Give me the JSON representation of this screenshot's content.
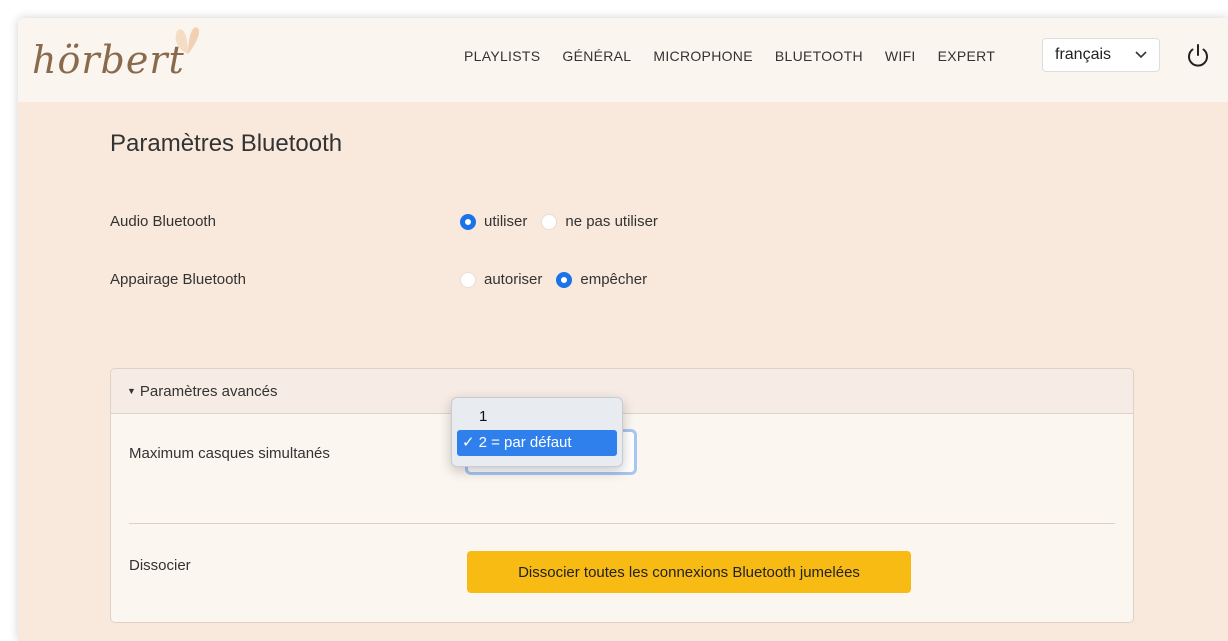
{
  "brand": {
    "logo_text": "hörbert"
  },
  "nav": {
    "links": [
      "PLAYLISTS",
      "GÉNÉRAL",
      "MICROPHONE",
      "BLUETOOTH",
      "WIFI",
      "EXPERT"
    ]
  },
  "language": {
    "selected": "français"
  },
  "page": {
    "title": "Paramètres Bluetooth"
  },
  "settings": {
    "audio": {
      "label": "Audio Bluetooth",
      "options": [
        "utiliser",
        "ne pas utiliser"
      ],
      "selected_index": 0
    },
    "pairing": {
      "label": "Appairage Bluetooth",
      "options": [
        "autoriser",
        "empêcher"
      ],
      "selected_index": 1
    }
  },
  "advanced": {
    "header": "Paramètres avancés",
    "max_headsets": {
      "label": "Maximum casques simultanés",
      "options": [
        "1",
        "2 = par défaut"
      ],
      "selected": "2 = par défaut"
    },
    "unpair": {
      "label": "Dissocier",
      "button": "Dissocier toutes les connexions Bluetooth jumelées"
    }
  },
  "colors": {
    "accent": "#1a73e8",
    "button": "#f8bb13",
    "background": "#f8e9dc",
    "navbar": "#fbf5ef"
  }
}
